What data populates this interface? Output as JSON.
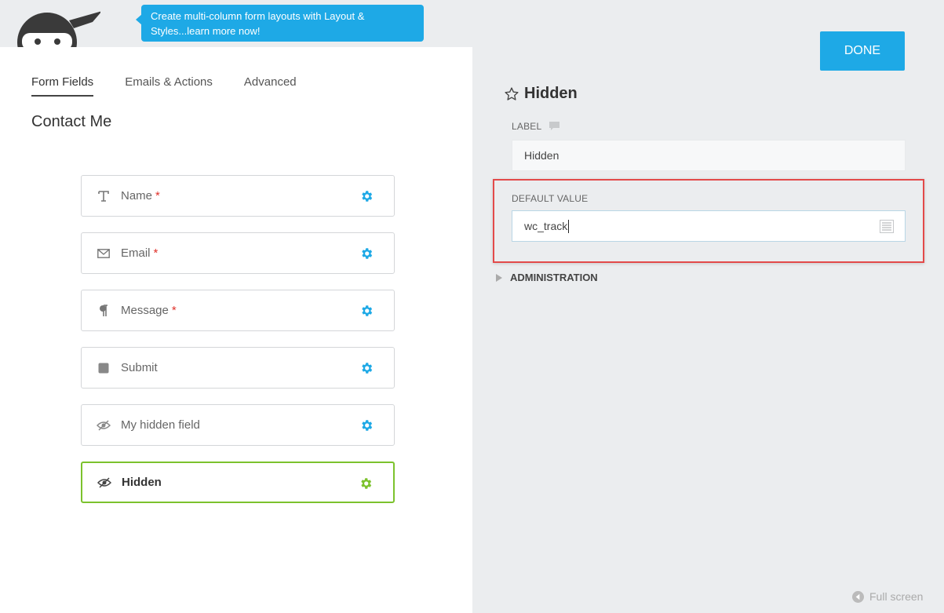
{
  "promo": {
    "text": "Create multi-column form layouts with Layout & Styles...learn more now!"
  },
  "tabs": [
    "Form Fields",
    "Emails & Actions",
    "Advanced"
  ],
  "form": {
    "title": "Contact Me",
    "fields": [
      {
        "label": "Name",
        "required": "*",
        "icon": "text-icon"
      },
      {
        "label": "Email",
        "required": "*",
        "icon": "envelope-icon"
      },
      {
        "label": "Message",
        "required": "*",
        "icon": "paragraph-icon"
      },
      {
        "label": "Submit",
        "required": "",
        "icon": "button-icon"
      },
      {
        "label": "My hidden field",
        "required": "",
        "icon": "eye-slash-icon"
      },
      {
        "label": "Hidden",
        "required": "",
        "icon": "eye-slash-icon"
      }
    ]
  },
  "panel": {
    "done_label": "DONE",
    "title": "Hidden",
    "label_heading": "LABEL",
    "label_value": "Hidden",
    "default_heading": "DEFAULT VALUE",
    "default_value": "wc_track",
    "administration": "ADMINISTRATION",
    "fullscreen": "Full screen"
  },
  "colors": {
    "accent": "#1ea9e6",
    "selected": "#7cc22d",
    "highlight": "#e34a4a",
    "required": "#e0322b"
  }
}
